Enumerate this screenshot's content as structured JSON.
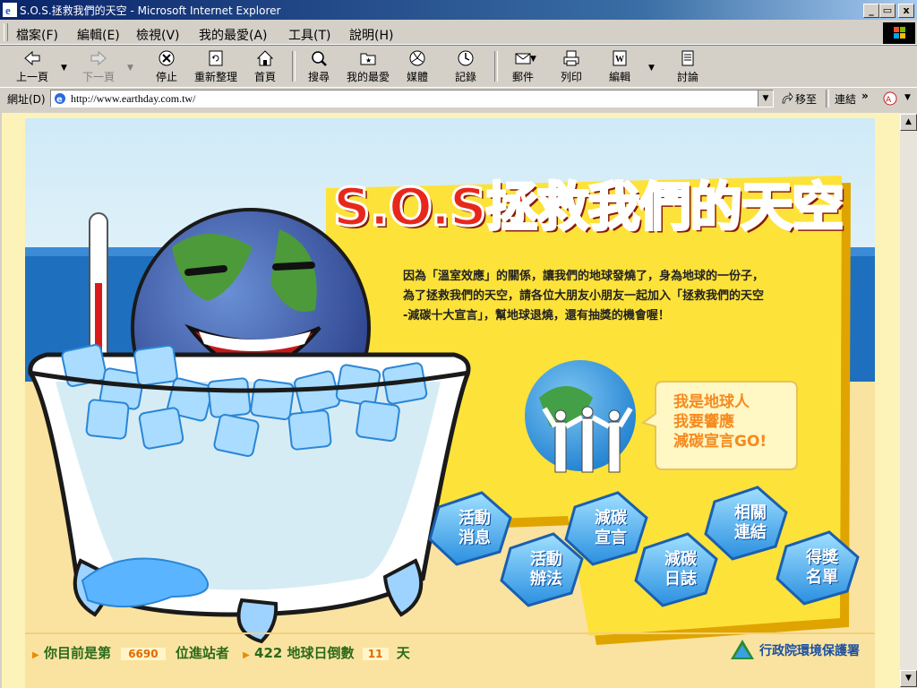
{
  "window": {
    "title": "S.O.S.拯救我們的天空 - Microsoft Internet Explorer",
    "controls": [
      "_",
      "▭",
      "x"
    ]
  },
  "menu": [
    "檔案(F)",
    "編輯(E)",
    "檢視(V)",
    "我的最愛(A)",
    "工具(T)",
    "說明(H)"
  ],
  "toolbar": {
    "back": "上一頁",
    "forward": "下一頁",
    "stop": "停止",
    "refresh": "重新整理",
    "home": "首頁",
    "search": "搜尋",
    "favorites": "我的最愛",
    "media": "媒體",
    "history": "記錄",
    "mail": "郵件",
    "print": "列印",
    "edit": "編輯",
    "discuss": "討論"
  },
  "address": {
    "label": "網址(D)",
    "url": "http://www.earthday.com.tw/",
    "go": "移至",
    "links": "連結",
    "links_arrow": "»"
  },
  "page": {
    "headline": "S.O.S拯救我們的天空",
    "intro": [
      "因為「溫室效應」的關係，讓我們的地球發燒了，身為地球的一份子，",
      "為了拯救我們的天空，請各位大朋友小朋友一起加入「拯救我們的天空",
      "-減碳十大宣言」，幫地球退燒，還有抽獎的機會喔！"
    ],
    "bubble": [
      "我是地球人",
      "我要響應",
      "減碳宣言GO!"
    ],
    "nav": [
      {
        "line1": "活動",
        "line2": "消息"
      },
      {
        "line1": "活動",
        "line2": "辦法"
      },
      {
        "line1": "減碳",
        "line2": "宣言"
      },
      {
        "line1": "減碳",
        "line2": "日誌"
      },
      {
        "line1": "相關",
        "line2": "連結"
      },
      {
        "line1": "得獎",
        "line2": "名單"
      }
    ],
    "footer": {
      "visitor_prefix": "你目前是第",
      "visitor_count": "6690",
      "visitor_suffix": "位進站者",
      "countdown_prefix": "422 地球日倒數",
      "countdown_days": "11",
      "countdown_suffix": "天",
      "agency": "行政院環境保護署"
    }
  }
}
